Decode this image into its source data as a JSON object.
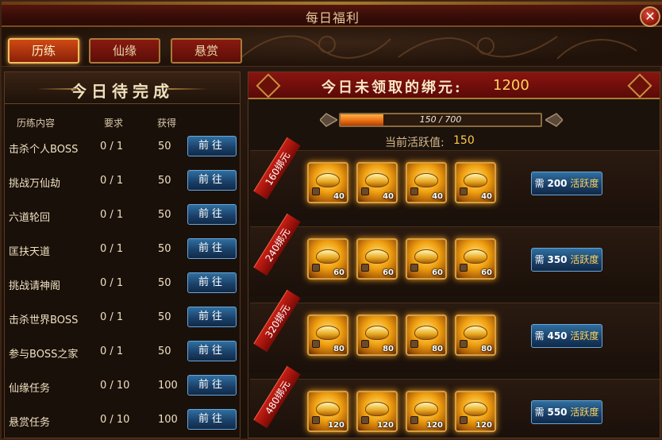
{
  "window": {
    "title": "每日福利"
  },
  "tabs": [
    {
      "label": "历练",
      "active": true
    },
    {
      "label": "仙缘",
      "active": false
    },
    {
      "label": "悬赏",
      "active": false
    }
  ],
  "left": {
    "title": "今日待完成",
    "columns": {
      "name": "历练内容",
      "req": "要求",
      "reward": "获得"
    },
    "go_label": "前往",
    "tasks": [
      {
        "name": "击杀个人BOSS",
        "req": "0 / 1",
        "reward": "50"
      },
      {
        "name": "挑战万仙劫",
        "req": "0 / 1",
        "reward": "50"
      },
      {
        "name": "六道轮回",
        "req": "0 / 1",
        "reward": "50"
      },
      {
        "name": "匡扶天道",
        "req": "0 / 1",
        "reward": "50"
      },
      {
        "name": "挑战请神阁",
        "req": "0 / 1",
        "reward": "50"
      },
      {
        "name": "击杀世界BOSS",
        "req": "0 / 1",
        "reward": "50"
      },
      {
        "name": "参与BOSS之家",
        "req": "0 / 1",
        "reward": "50"
      },
      {
        "name": "仙缘任务",
        "req": "0 / 10",
        "reward": "100"
      },
      {
        "name": "悬赏任务",
        "req": "0 / 10",
        "reward": "100"
      }
    ]
  },
  "right": {
    "banner_label": "今日未领取的绑元:",
    "banner_value": "1200",
    "progress": {
      "text": "150 / 700",
      "current": 150,
      "max": 700
    },
    "activity_label": "当前活跃值:",
    "activity_value": "150",
    "need_prefix": "需",
    "need_suffix": "活跃度",
    "tiers": [
      {
        "ribbon": "160绑元",
        "qty": "40",
        "need": "200"
      },
      {
        "ribbon": "240绑元",
        "qty": "60",
        "need": "350"
      },
      {
        "ribbon": "320绑元",
        "qty": "80",
        "need": "450"
      },
      {
        "ribbon": "480绑元",
        "qty": "120",
        "need": "550"
      }
    ]
  },
  "colors": {
    "accent_gold": "#ffc94a",
    "button_blue": "#1a3e66",
    "banner_red": "#8a1410"
  },
  "icons": {
    "close": "close-icon",
    "reward": "gold-ingot-icon",
    "lock": "lock-icon"
  }
}
